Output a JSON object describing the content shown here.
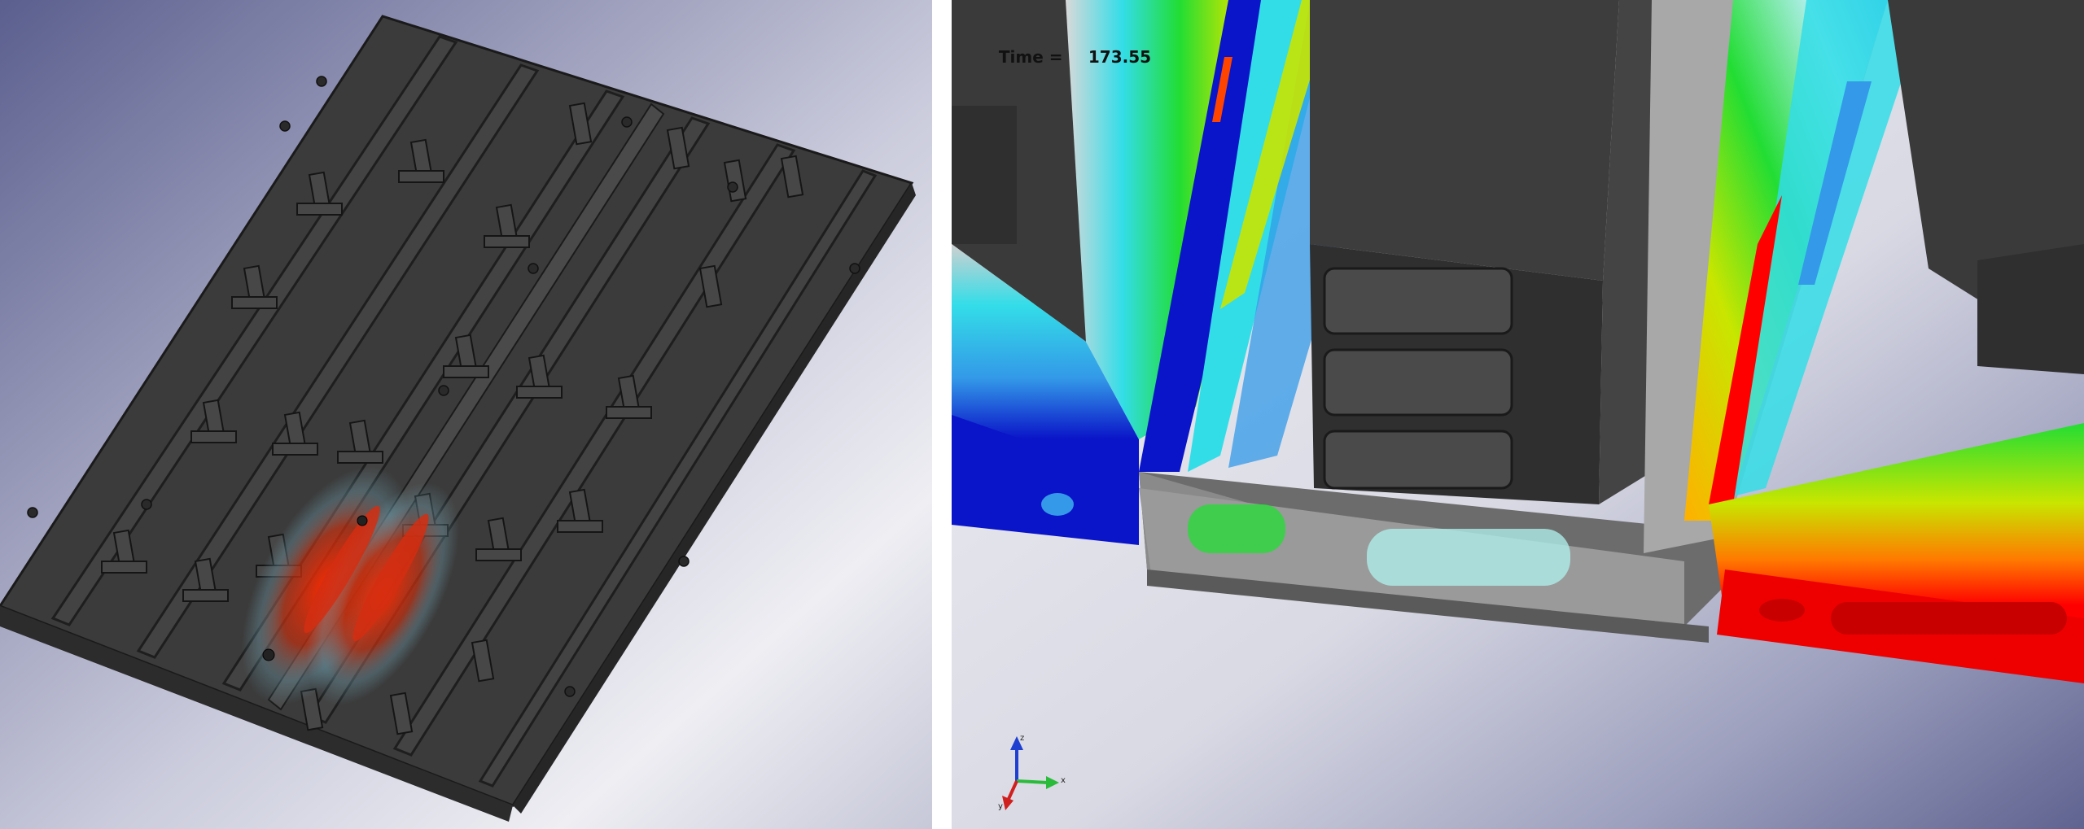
{
  "views": {
    "left": {
      "name": "overview-model-view"
    },
    "right": {
      "name": "zoomed-contour-view",
      "time_label": "Time =",
      "time_value": "173.55"
    }
  },
  "triad": {
    "x_label": "x",
    "y_label": "y",
    "z_label": "z"
  },
  "colors": {
    "background_top": "#5f648f",
    "background_bottom": "#eceef4",
    "model_dark": "#3a3a3a",
    "contour_red": "#ff0000",
    "contour_orange": "#ff7a00",
    "contour_yellow": "#c8e600",
    "contour_green": "#22dd33",
    "contour_cyan": "#33dde8",
    "contour_lightblue": "#3399e8",
    "contour_blue": "#0a14c8"
  }
}
